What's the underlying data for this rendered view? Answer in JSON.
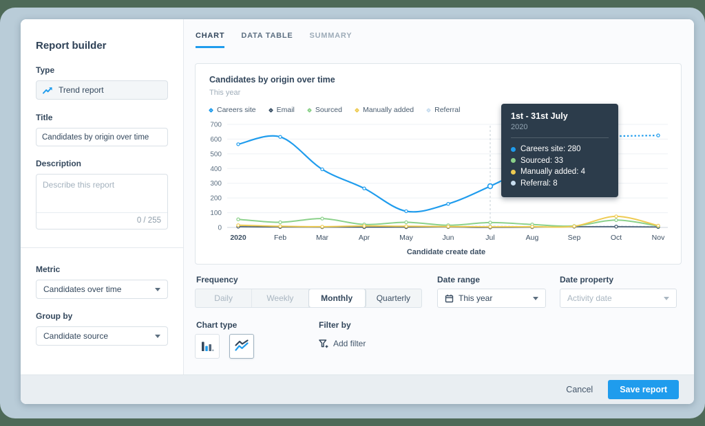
{
  "sidebar": {
    "title": "Report builder",
    "type": {
      "label": "Type",
      "value": "Trend report"
    },
    "title_field": {
      "label": "Title",
      "value": "Candidates by origin over time"
    },
    "description": {
      "label": "Description",
      "placeholder": "Describe this report",
      "counter": "0 / 255"
    },
    "metric": {
      "label": "Metric",
      "value": "Candidates over time"
    },
    "group_by": {
      "label": "Group by",
      "value": "Candidate source"
    }
  },
  "tabs": [
    {
      "label": "CHART",
      "active": true
    },
    {
      "label": "DATA TABLE",
      "active": false
    },
    {
      "label": "SUMMARY",
      "active": false
    }
  ],
  "chart_card": {
    "title": "Candidates by origin over time",
    "subtitle": "This year"
  },
  "chart_data": {
    "type": "line",
    "title": "Candidates by origin over time",
    "subtitle": "This year",
    "x": [
      "2020",
      "Feb",
      "Mar",
      "Apr",
      "May",
      "Jun",
      "Jul",
      "Aug",
      "Sep",
      "Oct",
      "Nov"
    ],
    "xlabel": "Candidate create date",
    "ylabel": "",
    "ylim": [
      0,
      700
    ],
    "yticks": [
      0,
      100,
      200,
      300,
      400,
      500,
      600,
      700
    ],
    "grid": true,
    "legend_position": "top",
    "highlight_index": 6,
    "series": [
      {
        "name": "Careers site",
        "color": "#1f9ced",
        "values": [
          565,
          615,
          395,
          265,
          110,
          160,
          280,
          420,
          550,
          620,
          625
        ],
        "highlight": true,
        "dash_last_segment": true,
        "width": 2.2
      },
      {
        "name": "Email",
        "color": "#3d5368",
        "values": [
          5,
          3,
          2,
          2,
          2,
          3,
          0,
          2,
          5,
          5,
          3
        ],
        "width": 1.5
      },
      {
        "name": "Sourced",
        "color": "#8bd18a",
        "values": [
          55,
          35,
          60,
          20,
          35,
          15,
          33,
          20,
          10,
          50,
          10
        ],
        "width": 2
      },
      {
        "name": "Manually added",
        "color": "#eecb52",
        "values": [
          15,
          8,
          5,
          10,
          8,
          6,
          4,
          5,
          8,
          75,
          12
        ],
        "width": 2
      },
      {
        "name": "Referral",
        "color": "#c9def0",
        "values": [
          8,
          5,
          3,
          5,
          5,
          5,
          8,
          5,
          5,
          8,
          5
        ],
        "line_style": "dashed",
        "width": 1.8
      }
    ]
  },
  "tooltip": {
    "title": "1st - 31st July",
    "subtitle": "2020",
    "rows": [
      {
        "text": "Careers site: 280",
        "color": "#1f9ced"
      },
      {
        "text": "Sourced: 33",
        "color": "#8bd18a"
      },
      {
        "text": "Manually added: 4",
        "color": "#eecb52"
      },
      {
        "text": "Referral: 8",
        "color": "#c9def0"
      }
    ]
  },
  "controls": {
    "frequency": {
      "label": "Frequency",
      "segments": [
        {
          "label": "Daily",
          "state": "muted"
        },
        {
          "label": "Weekly",
          "state": "muted"
        },
        {
          "label": "Monthly",
          "state": "active"
        },
        {
          "label": "Quarterly",
          "state": "normal"
        }
      ]
    },
    "date_range": {
      "label": "Date range",
      "value": "This year"
    },
    "date_property": {
      "label": "Date property",
      "value": "Activity date"
    },
    "chart_type": {
      "label": "Chart type"
    },
    "filter_by": {
      "label": "Filter by",
      "add_label": "Add filter"
    }
  },
  "footer": {
    "cancel": "Cancel",
    "save": "Save report"
  },
  "colors": {
    "accent": "#1f9ced",
    "tooltip_bg": "#2c3c4b",
    "page_outer": "#4e6a58",
    "page_frame": "#b9ccd8"
  }
}
